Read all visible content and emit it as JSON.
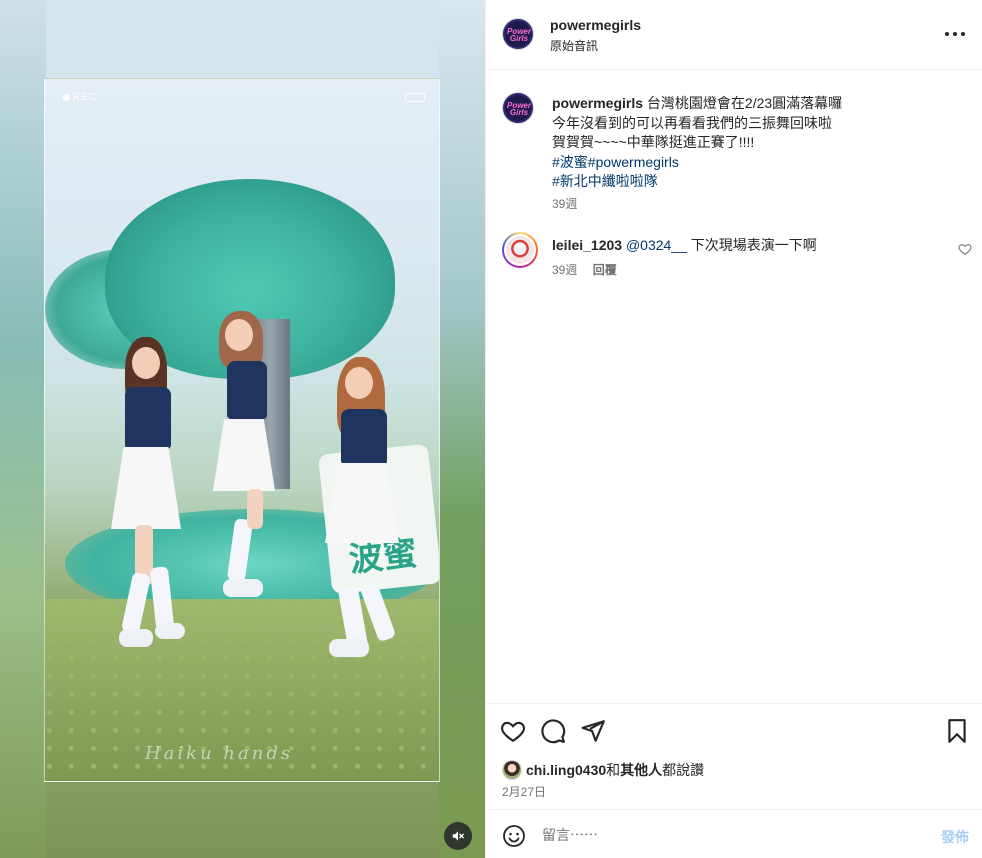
{
  "header": {
    "username": "powermegirls",
    "audio_label": "原始音訊",
    "avatar_logo": "Power Girls"
  },
  "media": {
    "rec_label": "REC",
    "sign_text": "波蜜",
    "watermark": "Haiku hands"
  },
  "caption": {
    "username": "powermegirls",
    "line1": "台灣桃園燈會在2/23圓滿落幕囉",
    "line2": "今年沒看到的可以再看看我們的三振舞回味啦",
    "line3": "賀賀賀~~~~中華隊挺進正賽了!!!!",
    "hashtags_line1": [
      "#波蜜",
      "#powermegirls"
    ],
    "hashtags_line2": [
      "#新北中纖啦啦隊"
    ],
    "time": "39週"
  },
  "comment": {
    "username": "leilei_1203",
    "mention": "@0324__",
    "text": "下次現場表演一下啊",
    "time": "39週",
    "reply_label": "回覆"
  },
  "likes": {
    "user": "chi.ling0430",
    "joiner": "和",
    "others": "其他人",
    "suffix": "都說讚"
  },
  "date": "2月27日",
  "composer": {
    "placeholder": "留言⋯⋯",
    "post_label": "發佈"
  }
}
